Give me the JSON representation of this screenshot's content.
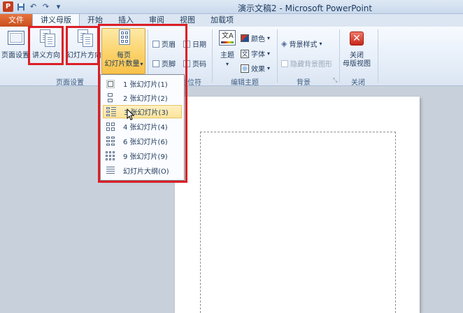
{
  "window": {
    "title": "演示文稿2 - Microsoft PowerPoint",
    "qat_icons": [
      "powerpoint-logo-icon",
      "save-icon",
      "undo-icon",
      "redo-icon",
      "customize-qat-icon"
    ]
  },
  "tabs": [
    {
      "label": "文件",
      "active": false
    },
    {
      "label": "讲义母版",
      "active": true
    },
    {
      "label": "开始",
      "active": false
    },
    {
      "label": "插入",
      "active": false
    },
    {
      "label": "审阅",
      "active": false
    },
    {
      "label": "视图",
      "active": false
    },
    {
      "label": "加载项",
      "active": false
    }
  ],
  "ribbon": {
    "page_setup_group": {
      "label": "页面设置",
      "page_setup": "页面设置",
      "handout_orientation": "讲义方向",
      "slide_orientation": "幻灯片方向",
      "slides_per_page_line1": "每页",
      "slides_per_page_line2": "幻灯片数量"
    },
    "placeholders_group": {
      "label": "占位符",
      "header": "页眉",
      "date": "日期",
      "footer": "页脚",
      "page_number": "页码"
    },
    "edit_theme_group": {
      "label": "编辑主题",
      "theme": "主题",
      "colors": "颜色",
      "fonts": "字体",
      "effects": "效果"
    },
    "background_group": {
      "label": "背景",
      "background_styles": "背景样式",
      "hide_background": "隐藏背景图形"
    },
    "close_group": {
      "label": "关闭",
      "close_line1": "关闭",
      "close_line2": "母版视图"
    }
  },
  "dropdown": {
    "items": [
      {
        "label": "1 张幻灯片(1)",
        "icon": "one-slide-icon"
      },
      {
        "label": "2 张幻灯片(2)",
        "icon": "two-slides-icon"
      },
      {
        "label": "3 张幻灯片(3)",
        "icon": "three-slides-icon",
        "hover": true
      },
      {
        "label": "4 张幻灯片(4)",
        "icon": "four-slides-icon"
      },
      {
        "label": "6 张幻灯片(6)",
        "icon": "six-slides-icon"
      },
      {
        "label": "9 张幻灯片(9)",
        "icon": "nine-slides-icon"
      },
      {
        "label": "幻灯片大纲(O)",
        "icon": "outline-icon"
      }
    ]
  },
  "colors": {
    "highlight_red": "#dc1f26",
    "file_tab": "#c7501f",
    "ribbon_text": "#1e395b"
  }
}
